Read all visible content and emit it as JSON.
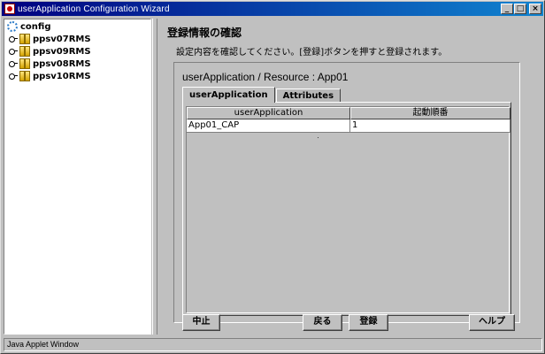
{
  "window": {
    "title": "userApplication Configuration Wizard",
    "controls": {
      "minimize": "_",
      "maximize": "□",
      "close": "×"
    }
  },
  "tree": {
    "root": "config",
    "items": [
      {
        "label": "ppsv07RMS"
      },
      {
        "label": "ppsv09RMS"
      },
      {
        "label": "ppsv08RMS"
      },
      {
        "label": "ppsv10RMS"
      }
    ]
  },
  "main": {
    "heading": "登録情報の確認",
    "instruction": "設定内容を確認してください。[登録]ボタンを押すと登録されます。",
    "resource_label": "userApplication / Resource  :  App01",
    "tabs": [
      {
        "label": "userApplication",
        "active": true
      },
      {
        "label": "Attributes",
        "active": false
      }
    ],
    "table": {
      "columns": [
        "userApplication",
        "起動順番"
      ],
      "rows": [
        [
          "App01_CAP",
          "1"
        ]
      ]
    }
  },
  "buttons": {
    "cancel": "中止",
    "back": "戻る",
    "register": "登録",
    "help": "ヘルプ"
  },
  "status": "Java Applet Window"
}
